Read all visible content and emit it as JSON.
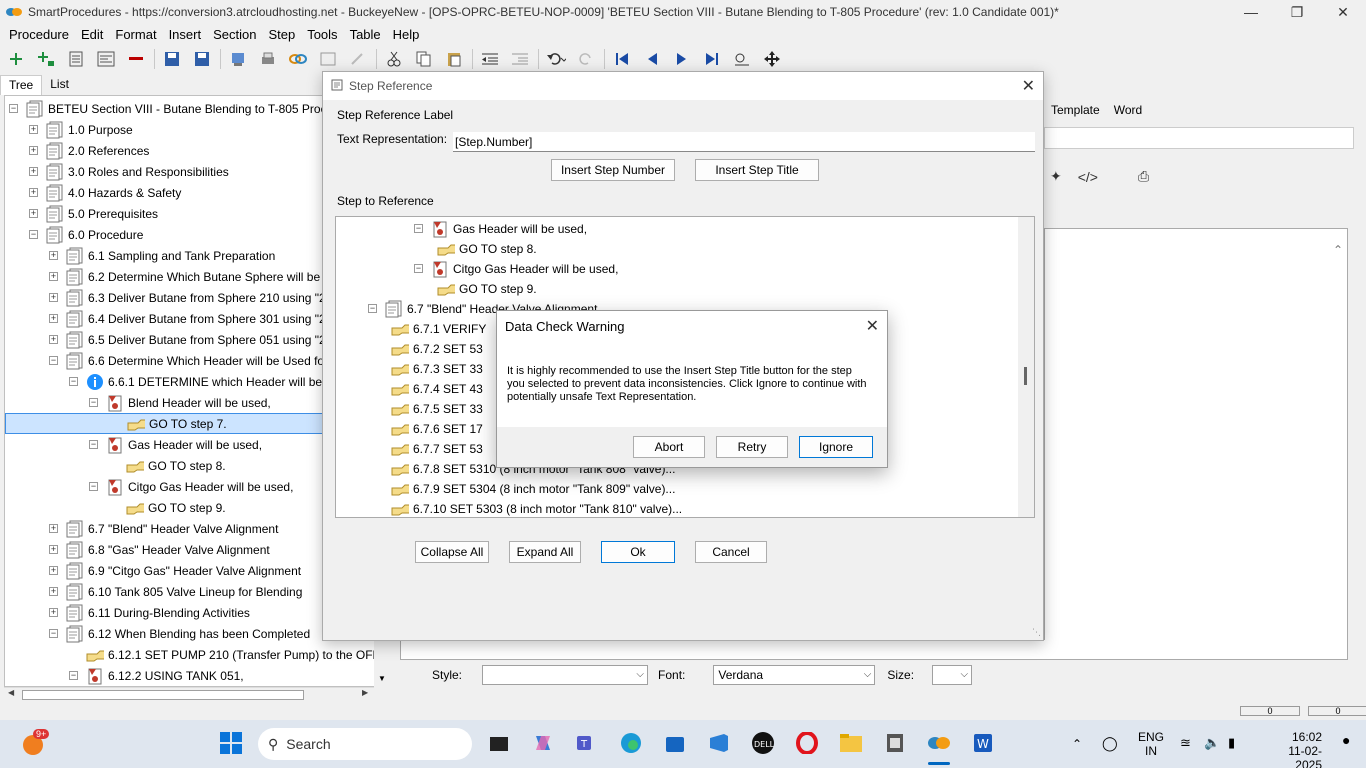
{
  "window": {
    "title": "SmartProcedures - https://conversion3.atrcloudhosting.net - BuckeyeNew - [OPS-OPRC-BETEU-NOP-0009] 'BETEU Section VIII - Butane Blending to T-805 Procedure' (rev: 1.0 Candidate 001)*"
  },
  "menu": [
    "Procedure",
    "Edit",
    "Format",
    "Insert",
    "Section",
    "Step",
    "Tools",
    "Table",
    "Help"
  ],
  "left_tabs": [
    "Tree",
    "List"
  ],
  "tree": [
    {
      "label": "BETEU Section VIII - Butane Blending to T-805 Proced",
      "level": 0,
      "exp": "-",
      "icon": "doc"
    },
    {
      "label": "1.0 Purpose",
      "level": 1,
      "exp": "+",
      "icon": "doc"
    },
    {
      "label": "2.0 References",
      "level": 1,
      "exp": "+",
      "icon": "doc"
    },
    {
      "label": "3.0 Roles and Responsibilities",
      "level": 1,
      "exp": "+",
      "icon": "doc"
    },
    {
      "label": "4.0 Hazards & Safety",
      "level": 1,
      "exp": "+",
      "icon": "doc"
    },
    {
      "label": "5.0 Prerequisites",
      "level": 1,
      "exp": "+",
      "icon": "doc"
    },
    {
      "label": "6.0 Procedure",
      "level": 1,
      "exp": "-",
      "icon": "doc"
    },
    {
      "label": "6.1 Sampling and Tank Preparation",
      "level": 2,
      "exp": "+",
      "icon": "doc"
    },
    {
      "label": "6.2 Determine Which Butane Sphere will be Us...",
      "level": 2,
      "exp": "+",
      "icon": "doc"
    },
    {
      "label": "6.3 Deliver Butane from Sphere 210 using \"21...",
      "level": 2,
      "exp": "+",
      "icon": "doc"
    },
    {
      "label": "6.4 Deliver Butane from Sphere 301 using \"21...",
      "level": 2,
      "exp": "+",
      "icon": "doc"
    },
    {
      "label": "6.5 Deliver Butane from Sphere 051 using \"21...",
      "level": 2,
      "exp": "+",
      "icon": "doc"
    },
    {
      "label": "6.6 Determine Which Header will be Used for ...",
      "level": 2,
      "exp": "-",
      "icon": "doc"
    },
    {
      "label": "6.6.1 DETERMINE which Header will be used",
      "level": 3,
      "exp": "-",
      "icon": "info"
    },
    {
      "label": "Blend Header will be used,",
      "level": 4,
      "exp": "-",
      "icon": "cond"
    },
    {
      "label": "GO TO step 7.",
      "level": 5,
      "exp": "",
      "icon": "hand",
      "selected": true
    },
    {
      "label": "Gas Header will be used,",
      "level": 4,
      "exp": "-",
      "icon": "cond"
    },
    {
      "label": "GO TO step 8.",
      "level": 5,
      "exp": "",
      "icon": "hand"
    },
    {
      "label": "Citgo Gas Header will be used,",
      "level": 4,
      "exp": "-",
      "icon": "cond"
    },
    {
      "label": "GO TO step 9.",
      "level": 5,
      "exp": "",
      "icon": "hand"
    },
    {
      "label": "6.7 \"Blend\" Header Valve Alignment",
      "level": 2,
      "exp": "+",
      "icon": "doc"
    },
    {
      "label": "6.8 \"Gas\" Header Valve Alignment",
      "level": 2,
      "exp": "+",
      "icon": "doc"
    },
    {
      "label": "6.9 \"Citgo Gas\" Header Valve Alignment",
      "level": 2,
      "exp": "+",
      "icon": "doc"
    },
    {
      "label": "6.10 Tank 805 Valve Lineup for Blending",
      "level": 2,
      "exp": "+",
      "icon": "doc"
    },
    {
      "label": "6.11 During-Blending Activities",
      "level": 2,
      "exp": "+",
      "icon": "doc"
    },
    {
      "label": "6.12 When Blending has been Completed",
      "level": 2,
      "exp": "-",
      "icon": "doc"
    },
    {
      "label": "6.12.1 SET PUMP 210 (Transfer Pump) to the OFF...",
      "level": 3,
      "exp": "",
      "icon": "hand"
    },
    {
      "label": "6.12.2 USING TANK 051,",
      "level": 3,
      "exp": "-",
      "icon": "cond"
    }
  ],
  "right_tabs": [
    "Template",
    "Word"
  ],
  "stylebar": {
    "style_label": "Style:",
    "style_value": "",
    "font_label": "Font:",
    "font_value": "Verdana",
    "size_label": "Size:",
    "size_value": ""
  },
  "step_reference": {
    "title": "Step Reference",
    "label_group": "Step Reference Label",
    "text_rep_label": "Text Representation:",
    "text_rep_value": "[Step.Number]",
    "insert_step_number": "Insert Step Number",
    "insert_step_title": "Insert Step Title",
    "step_group": "Step to Reference",
    "tree": [
      {
        "label": "Gas Header will be used,",
        "x": 0,
        "exp": "-",
        "icon": "cond"
      },
      {
        "label": "GO TO step 8.",
        "x": 1,
        "exp": "",
        "icon": "hand"
      },
      {
        "label": "Citgo Gas Header will be used,",
        "x": 0,
        "exp": "-",
        "icon": "cond"
      },
      {
        "label": "GO TO step 9.",
        "x": 1,
        "exp": "",
        "icon": "hand"
      },
      {
        "label": "6.7 \"Blend\" Header Valve Alignment",
        "x": -2,
        "exp": "-",
        "icon": "doc"
      },
      {
        "label": "6.7.1 VERIFY",
        "x": -1,
        "exp": "",
        "icon": "hand"
      },
      {
        "label": "6.7.2 SET 53",
        "x": -1,
        "exp": "",
        "icon": "hand"
      },
      {
        "label": "6.7.3 SET 33",
        "x": -1,
        "exp": "",
        "icon": "hand"
      },
      {
        "label": "6.7.4 SET 43",
        "x": -1,
        "exp": "",
        "icon": "hand"
      },
      {
        "label": "6.7.5 SET 33",
        "x": -1,
        "exp": "",
        "icon": "hand"
      },
      {
        "label": "6.7.6 SET 17",
        "x": -1,
        "exp": "",
        "icon": "hand"
      },
      {
        "label": "6.7.7 SET 53",
        "x": -1,
        "exp": "",
        "icon": "hand"
      },
      {
        "label": "6.7.8 SET 5310 (8 inch motor \"Tank 808\" valve)...",
        "x": -1,
        "exp": "",
        "icon": "hand"
      },
      {
        "label": "6.7.9 SET 5304 (8 inch motor \"Tank 809\" valve)...",
        "x": -1,
        "exp": "",
        "icon": "hand"
      },
      {
        "label": "6.7.10 SET 5303 (8 inch motor \"Tank 810\" valve)...",
        "x": -1,
        "exp": "",
        "icon": "hand"
      }
    ],
    "collapse_all": "Collapse All",
    "expand_all": "Expand All",
    "ok": "Ok",
    "cancel": "Cancel"
  },
  "warning": {
    "title": "Data Check Warning",
    "message": "It is highly recommended to use the Insert Step Title button  for the step you selected to prevent data inconsistencies.  Click Ignore to continue with potentially unsafe Text Representation.",
    "abort": "Abort",
    "retry": "Retry",
    "ignore": "Ignore"
  },
  "taskbar": {
    "search_placeholder": "Search",
    "notification_badge": "9+",
    "lang_top": "ENG",
    "lang_bottom": "IN",
    "time": "16:02",
    "date": "11-02-2025"
  },
  "colors": {
    "accent": "#0078d7",
    "selection": "#cce4ff",
    "doc_icon": "#8a8a8a",
    "cond_icon": "#c0392b",
    "hand_icon": "#e8c25a"
  }
}
